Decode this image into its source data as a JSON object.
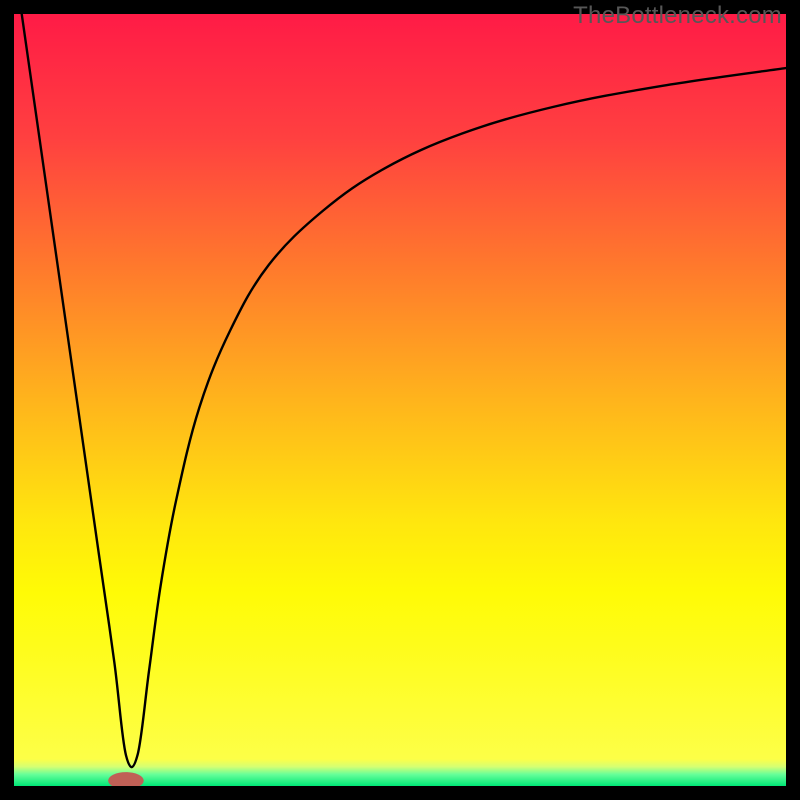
{
  "watermark": "TheBottleneck.com",
  "chart_data": {
    "type": "line",
    "title": "",
    "xlabel": "",
    "ylabel": "",
    "xlim": [
      0,
      100
    ],
    "ylim": [
      0,
      100
    ],
    "grid": false,
    "legend": false,
    "description": "Bottleneck percentage curve over a vertical gradient from red (top) through orange/yellow to green (bottom). Curve plunges from top-left to a minimum near x≈15 at y≈0, then rises asymptotically toward ~93 at the right edge.",
    "gradient_stops": [
      {
        "offset": 0.0,
        "color": "#ff1b46"
      },
      {
        "offset": 0.16,
        "color": "#ff4040"
      },
      {
        "offset": 0.33,
        "color": "#ff7a2c"
      },
      {
        "offset": 0.5,
        "color": "#ffb41c"
      },
      {
        "offset": 0.66,
        "color": "#ffe70e"
      },
      {
        "offset": 0.75,
        "color": "#fffb06"
      },
      {
        "offset": 0.965,
        "color": "#fdff47"
      },
      {
        "offset": 0.975,
        "color": "#d5ff73"
      },
      {
        "offset": 0.985,
        "color": "#66ff99"
      },
      {
        "offset": 1.0,
        "color": "#00e676"
      }
    ],
    "series": [
      {
        "name": "bottleneck-curve",
        "x": [
          1.0,
          3.0,
          5.0,
          7.0,
          9.0,
          11.0,
          13.0,
          14.5,
          16.0,
          17.5,
          19.0,
          21.0,
          24.0,
          28.0,
          33.0,
          40.0,
          48.0,
          58.0,
          70.0,
          84.0,
          100.0
        ],
        "y": [
          100.0,
          86.0,
          72.0,
          58.0,
          44.0,
          30.0,
          16.0,
          4.0,
          4.0,
          15.0,
          26.0,
          37.0,
          49.0,
          59.0,
          67.5,
          74.5,
          80.0,
          84.5,
          88.0,
          90.7,
          93.0
        ]
      }
    ],
    "marker": {
      "x": 14.5,
      "y": 0.7,
      "rx": 2.3,
      "ry": 1.1,
      "color": "#c06056"
    }
  }
}
